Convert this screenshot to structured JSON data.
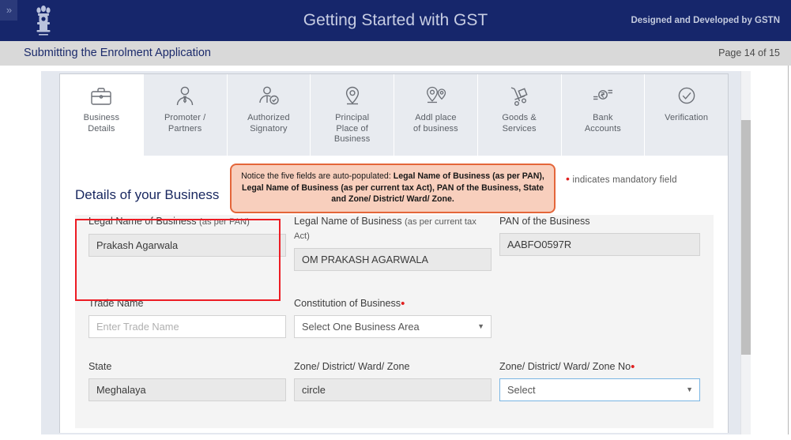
{
  "header": {
    "title": "Getting Started with GST",
    "credit": "Designed and Developed by GSTN",
    "emblem_icon": "india-national-emblem-icon",
    "expand_icon": "double-chevron-right-icon",
    "bg_color": "#16266b"
  },
  "subheader": {
    "title": "Submitting the Enrolment Application",
    "page_indicator": "Page 14 of 15",
    "bg_color": "#d9d9d9"
  },
  "tabs": [
    {
      "label": "Business\nDetails",
      "line1": "Business",
      "line2": "Details",
      "line3": "",
      "icon": "briefcase-icon",
      "active": true
    },
    {
      "label": "Promoter /\nPartners",
      "line1": "Promoter /",
      "line2": "Partners",
      "line3": "",
      "icon": "person-tie-icon",
      "active": false
    },
    {
      "label": "Authorized\nSignatory",
      "line1": "Authorized",
      "line2": "Signatory",
      "line3": "",
      "icon": "person-check-icon",
      "active": false
    },
    {
      "label": "Principal\nPlace of\nBusiness",
      "line1": "Principal",
      "line2": "Place of",
      "line3": "Business",
      "icon": "map-pin-icon",
      "active": false
    },
    {
      "label": "Addl place\nof business",
      "line1": "Addl place",
      "line2": "of business",
      "line3": "",
      "icon": "double-map-pin-icon",
      "active": false
    },
    {
      "label": "Goods &\nServices",
      "line1": "Goods &",
      "line2": "Services",
      "line3": "",
      "icon": "hand-truck-icon",
      "active": false
    },
    {
      "label": "Bank\nAccounts",
      "line1": "Bank",
      "line2": "Accounts",
      "line3": "",
      "icon": "rupee-coin-icon",
      "active": false
    },
    {
      "label": "Verification",
      "line1": "Verification",
      "line2": "",
      "line3": "",
      "icon": "check-circle-icon",
      "active": false
    }
  ],
  "notice": {
    "text_part1": "Notice the five fields are auto-populated: ",
    "text_bold": "Legal Name of Business (as per PAN), Legal Name of Business (as per current tax Act), PAN of the Business, State and Zone/ District/ Ward/ Zone.",
    "border_color": "#e4663a",
    "bg_color": "#f8cfbd"
  },
  "form": {
    "section_title": "Details of your Business",
    "mandatory_note": "indicates mandatory field",
    "mandatory_dot_color": "#e02020",
    "fields": {
      "legal_name_pan": {
        "label": "Legal Name of Business ",
        "label_sub": "(as per PAN)",
        "value": "Prakash Agarwala",
        "readonly": true
      },
      "legal_name_tax_act": {
        "label": "Legal Name of Business ",
        "label_sub": "(as per current tax Act)",
        "value": "OM PRAKASH AGARWALA",
        "readonly": true
      },
      "pan_of_business": {
        "label": "PAN of the Business",
        "label_sub": "",
        "value": "AABFO0597R",
        "readonly": true
      },
      "trade_name": {
        "label": "Trade Name",
        "placeholder": "Enter Trade Name",
        "value": ""
      },
      "constitution_of_business": {
        "label": "Constitution of Business",
        "required": true,
        "selected": "Select One Business Area"
      },
      "state": {
        "label": "State",
        "value": "Meghalaya",
        "readonly": true
      },
      "zone_district_ward_zone": {
        "label": "Zone/ District/ Ward/ Zone",
        "value": "circle",
        "readonly": true
      },
      "zone_district_ward_zone_no": {
        "label": "Zone/ District/ Ward/ Zone No",
        "required": true,
        "selected": "Select",
        "focused": true
      }
    },
    "highlight_box_color": "#ed1c24"
  }
}
